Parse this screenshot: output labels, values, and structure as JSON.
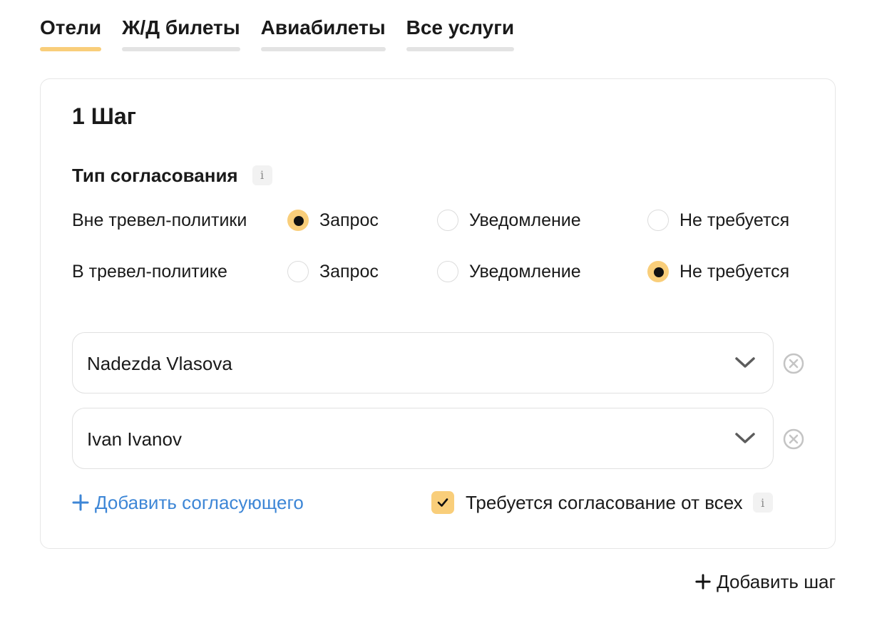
{
  "tabs": [
    {
      "label": "Отели",
      "active": true
    },
    {
      "label": "Ж/Д билеты",
      "active": false
    },
    {
      "label": "Авиабилеты",
      "active": false
    },
    {
      "label": "Все услуги",
      "active": false
    }
  ],
  "step": {
    "title": "1 Шаг",
    "approval_type": {
      "title": "Тип согласования",
      "info_icon": "i",
      "rows": [
        {
          "label": "Вне тревел-политики",
          "options": [
            "Запрос",
            "Уведомление",
            "Не требуется"
          ],
          "selected": "Запрос"
        },
        {
          "label": "В тревел-политике",
          "options": [
            "Запрос",
            "Уведомление",
            "Не требуется"
          ],
          "selected": "Не требуется"
        }
      ]
    },
    "approvers": [
      {
        "name": "Nadezda Vlasova"
      },
      {
        "name": "Ivan Ivanov"
      }
    ],
    "add_approver_label": "Добавить согласующего",
    "require_all": {
      "label": "Требуется согласование от всех",
      "checked": true,
      "info_icon": "i"
    }
  },
  "add_step_label": "Добавить шаг",
  "colors": {
    "accent": "#f9ce7a",
    "link": "#3d86d6",
    "inactive_tab_bar": "#e3e3e3"
  }
}
